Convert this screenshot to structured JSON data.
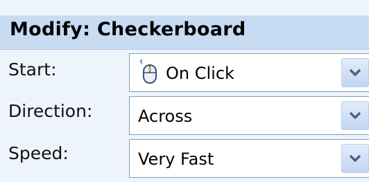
{
  "panel": {
    "title": "Modify: Checkerboard"
  },
  "rows": [
    {
      "label": "Start:",
      "value": "On Click",
      "icon": "mouse-click-icon"
    },
    {
      "label": "Direction:",
      "value": "Across"
    },
    {
      "label": "Speed:",
      "value": "Very Fast"
    }
  ],
  "colors": {
    "header_bg": "#c7dbf3",
    "panel_bg": "#eef4fb",
    "combo_border": "#7f9db9",
    "chevron": "#4d6185"
  }
}
